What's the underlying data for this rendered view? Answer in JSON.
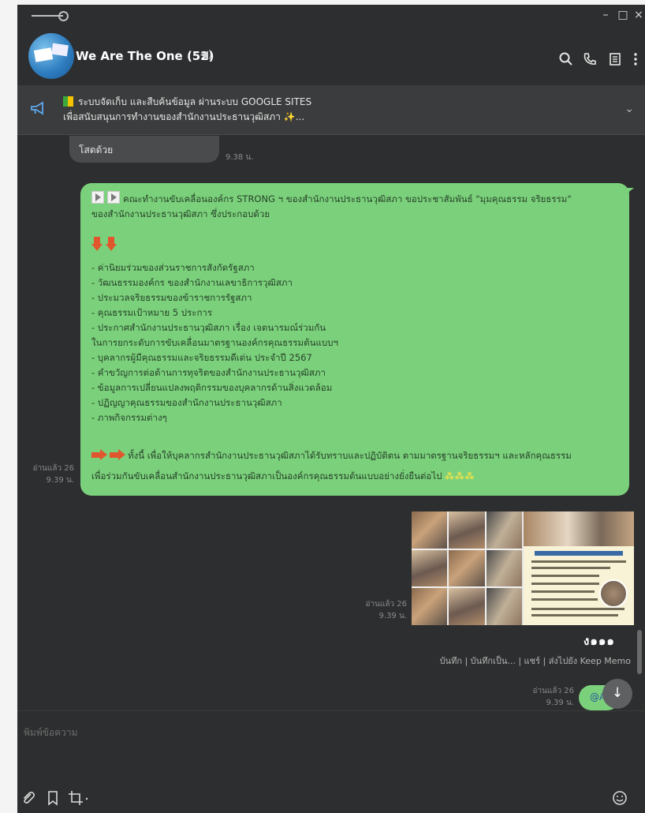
{
  "window": {
    "minimize_glyph": "–",
    "maximize_glyph": "□",
    "close_glyph": "×"
  },
  "header": {
    "title": "We Are The One (52)",
    "mute_glyph": "◀)",
    "icons": [
      "search-icon",
      "phone-icon",
      "notes-icon",
      "more-icon"
    ]
  },
  "announcement": {
    "line1": "ระบบจัดเก็บ และสืบค้นข้อมูล ผ่านระบบ GOOGLE SITES",
    "line2": "เพื่อสนับสนุนการทำงานของสำนักงานประธานวุฒิสภา",
    "line2_suffix": "...",
    "spark_glyph": "✨",
    "chevron": "⌄"
  },
  "messages": {
    "grey_bubble": {
      "text": "โสตด้วย",
      "time": "9.38 น."
    },
    "green_bubble": {
      "intro_line1": "คณะทำงานขับเคลื่อนองค์กร STRONG ฯ ของสำนักงานประธานวุฒิสภา ขอประชาสัมพันธ์ \"มุมคุณธรรม จริยธรรม\"",
      "intro_line2": "ของสำนักงานประธานวุฒิสภา ซึ่งประกอบด้วย",
      "items": [
        "- ค่านิยมร่วมของส่วนราชการสังกัดรัฐสภา",
        "- วัฒนธรรมองค์กร ของสำนักงานเลขาธิการวุฒิสภา",
        "- ประมวลจริยธรรมของข้าราชการรัฐสภา",
        "- คุณธรรมเป้าหมาย 5 ประการ",
        "- ประกาศสำนักงานประธานวุฒิสภา เรื่อง เจตนารมณ์ร่วมกัน",
        "ในการยกระดับการขับเคลื่อนมาตรฐานองค์กรคุณธรรมต้นแบบฯ",
        "- บุคลากรผู้มีคุณธรรมและจริยธรรมดีเด่น ประจำปี 2567",
        "- คำขวัญการต่อต้านการทุจริตของสำนักงานประธานวุฒิสภา",
        "- ข้อมูลการเปลี่ยนแปลงพฤติกรรมของบุคลากรด้านสิ่งแวดล้อม",
        "- ปฏิญญาคุณธรรมของสำนักงานประธานวุฒิสภา",
        "- ภาพกิจกรรมต่างๆ"
      ],
      "closing_line1": "ทั้งนี้ เพื่อให้บุคลากรสำนักงานประธานวุฒิสภาได้รับทราบและปฏิบัติตน ตามมาตรฐานจริยธรรมฯ และหลักคุณธรรม",
      "closing_line2": "เพื่อร่วมกันขับเคลื่อนสำนักงานประธานวุฒิสภาเป็นองค์กรคุณธรรมต้นแบบอย่างยั่งยืนต่อไป",
      "sparkles": "⁂⁂⁂",
      "read": "อ่านแล้ว 26",
      "time": "9.39 น."
    },
    "photos": {
      "read": "อ่านแล้ว 26",
      "time": "9.39 น."
    },
    "reaction_dots": "ง๑๑๑",
    "photo_actions": "บันทึก | บันทึกเป็น... | แชร์ | ส่งไปยัง Keep Memo",
    "last_bubble": {
      "text": "@A",
      "read": "อ่านแล้ว 26",
      "time": "9.39 น."
    },
    "scroll_down_glyph": "↓"
  },
  "composer": {
    "placeholder": "พิมพ์ข้อความ",
    "icons": [
      "attach-icon",
      "bookmark-icon",
      "crop-icon",
      "emoji-icon"
    ]
  }
}
